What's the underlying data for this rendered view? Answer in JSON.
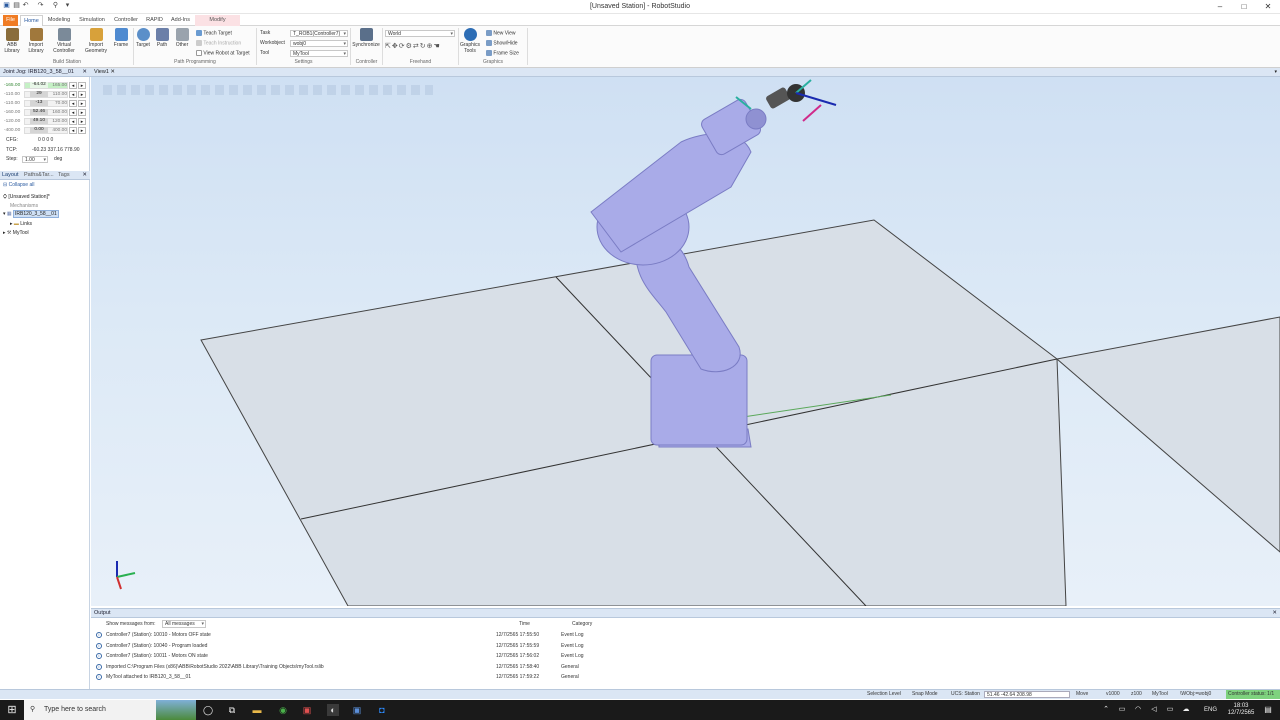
{
  "window": {
    "title": "[Unsaved Station] - RobotStudio"
  },
  "tabs": {
    "file": "File",
    "home": "Home",
    "modeling": "Modeling",
    "simulation": "Simulation",
    "controller": "Controller",
    "rapid": "RAPID",
    "addins": "Add-Ins",
    "modify": "Modify"
  },
  "ribbon": {
    "abb_library": "ABB Library",
    "import_library": "Import Library",
    "virtual_controller": "Virtual Controller",
    "import_geometry": "Import Geometry",
    "frame": "Frame",
    "target": "Target",
    "path": "Path",
    "other": "Other",
    "teach_target": "Teach Target",
    "teach_instruction": "Teach Instruction",
    "view_robot_at_target": "View Robot at Target",
    "task_label": "Task",
    "task_value": "T_ROB1(Controller7)",
    "workobject_label": "Workobject",
    "workobject_value": "wobj0",
    "tool_label": "Tool",
    "tool_value": "MyTool",
    "synchronize": "Synchronize",
    "freehand_world": "World",
    "graphics_tools": "Graphics Tools",
    "new_view": "New View",
    "show_hide": "Show/Hide",
    "frame_size": "Frame Size",
    "groups": {
      "build_station": "Build Station",
      "path_programming": "Path Programming",
      "settings": "Settings",
      "controller": "Controller",
      "freehand": "Freehand",
      "graphics": "Graphics"
    }
  },
  "joint_jog": {
    "title": "Joint Jog: IRB120_3_58__01",
    "rows": [
      {
        "lo": "-165.00",
        "val": "-64.02",
        "hi": "165.00"
      },
      {
        "lo": "-110.00",
        "val": "29",
        "hi": "110.00"
      },
      {
        "lo": "-110.00",
        "val": "-13",
        "hi": "70.00"
      },
      {
        "lo": "-160.00",
        "val": "52.46",
        "hi": "160.00"
      },
      {
        "lo": "-120.00",
        "val": "49.10",
        "hi": "120.00"
      },
      {
        "lo": "-400.00",
        "val": "0.00",
        "hi": "400.00"
      }
    ],
    "cfg_label": "CFG:",
    "cfg_value": "0 0 0 0",
    "tcp_label": "TCP:",
    "tcp_value": "-60.23 337.16 778.90",
    "step_label": "Step:",
    "step_value": "1.00",
    "step_unit": "deg"
  },
  "layout_panel": {
    "tabs": [
      "Layout",
      "Paths&Tar...",
      "Tags"
    ],
    "collapse_all": "Collapse all",
    "station": "[Unsaved Station]*",
    "mechanisms": "Mechanisms",
    "robot": "IRB120_3_58__01",
    "links": "Links",
    "tool": "MyTool"
  },
  "view": {
    "tab": "View1"
  },
  "output": {
    "title": "Output",
    "filter_label": "Show messages from:",
    "filter_value": "All messages",
    "col_time": "Time",
    "col_category": "Category",
    "rows": [
      {
        "msg": "Controller7 (Station): 10010 - Motors OFF state",
        "time": "12/7/2565 17:55:50",
        "cat": "Event Log"
      },
      {
        "msg": "Controller7 (Station): 10040 - Program loaded",
        "time": "12/7/2565 17:55:59",
        "cat": "Event Log"
      },
      {
        "msg": "Controller7 (Station): 10011 - Motors ON state",
        "time": "12/7/2565 17:56:02",
        "cat": "Event Log"
      },
      {
        "msg": "Imported C:\\Program Files (x86)\\ABB\\RobotStudio 2022\\ABB Library\\Training Objects\\myTool.rslib",
        "time": "12/7/2565 17:58:40",
        "cat": "General"
      },
      {
        "msg": "MyTool attached to IRB120_3_58__01",
        "time": "12/7/2565 17:59:22",
        "cat": "General"
      }
    ]
  },
  "status": {
    "selection_level": "Selection Level",
    "snap_mode": "Snap Mode",
    "ucs": "UCS: Station",
    "coords": "51.46  -42.64  208.98",
    "move": "Move",
    "speed": "v1000",
    "zone": "z100",
    "tool": "MyTool",
    "wobj": "\\WObj:=wobj0",
    "controller": "Controller status: 1/1"
  },
  "taskbar": {
    "search": "Type here to search",
    "lang": "ENG",
    "time": "18:03",
    "date": "12/7/2565"
  },
  "colors": {
    "accent": "#f07c24",
    "panel": "#dbe6f4",
    "robot": "#a8a9e6",
    "floor": "#d6dde6"
  }
}
